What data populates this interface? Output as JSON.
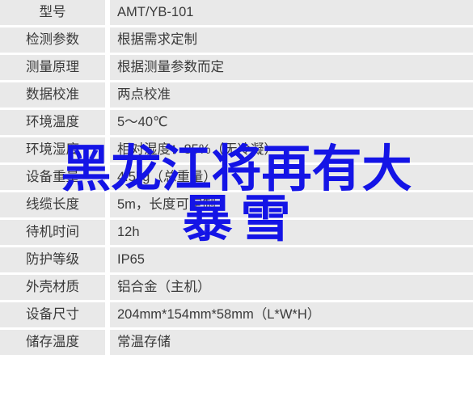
{
  "spec_table": {
    "rows": [
      {
        "label": "型号",
        "value": "AMT/YB-101"
      },
      {
        "label": "检测参数",
        "value": "根据需求定制"
      },
      {
        "label": "测量原理",
        "value": "根据测量参数而定"
      },
      {
        "label": "数据校准",
        "value": "两点校准"
      },
      {
        "label": "环境温度",
        "value": "5～40℃"
      },
      {
        "label": "环境湿度",
        "value": "相对湿度：85%（无冷凝）"
      },
      {
        "label": "设备重量",
        "value": "4.5kg（总重量）"
      },
      {
        "label": "线缆长度",
        "value": "5m，长度可定制"
      },
      {
        "label": "待机时间",
        "value": "12h"
      },
      {
        "label": "防护等级",
        "value": "IP65"
      },
      {
        "label": "外壳材质",
        "value": "铝合金（主机）"
      },
      {
        "label": "设备尺寸",
        "value": "204mm*154mm*58mm（L*W*H）"
      },
      {
        "label": "储存温度",
        "value": "常温存储"
      }
    ]
  },
  "headline_overlay": {
    "line1": "黑龙江将再有大",
    "line2": "暴雪",
    "color": "#1414e6"
  }
}
